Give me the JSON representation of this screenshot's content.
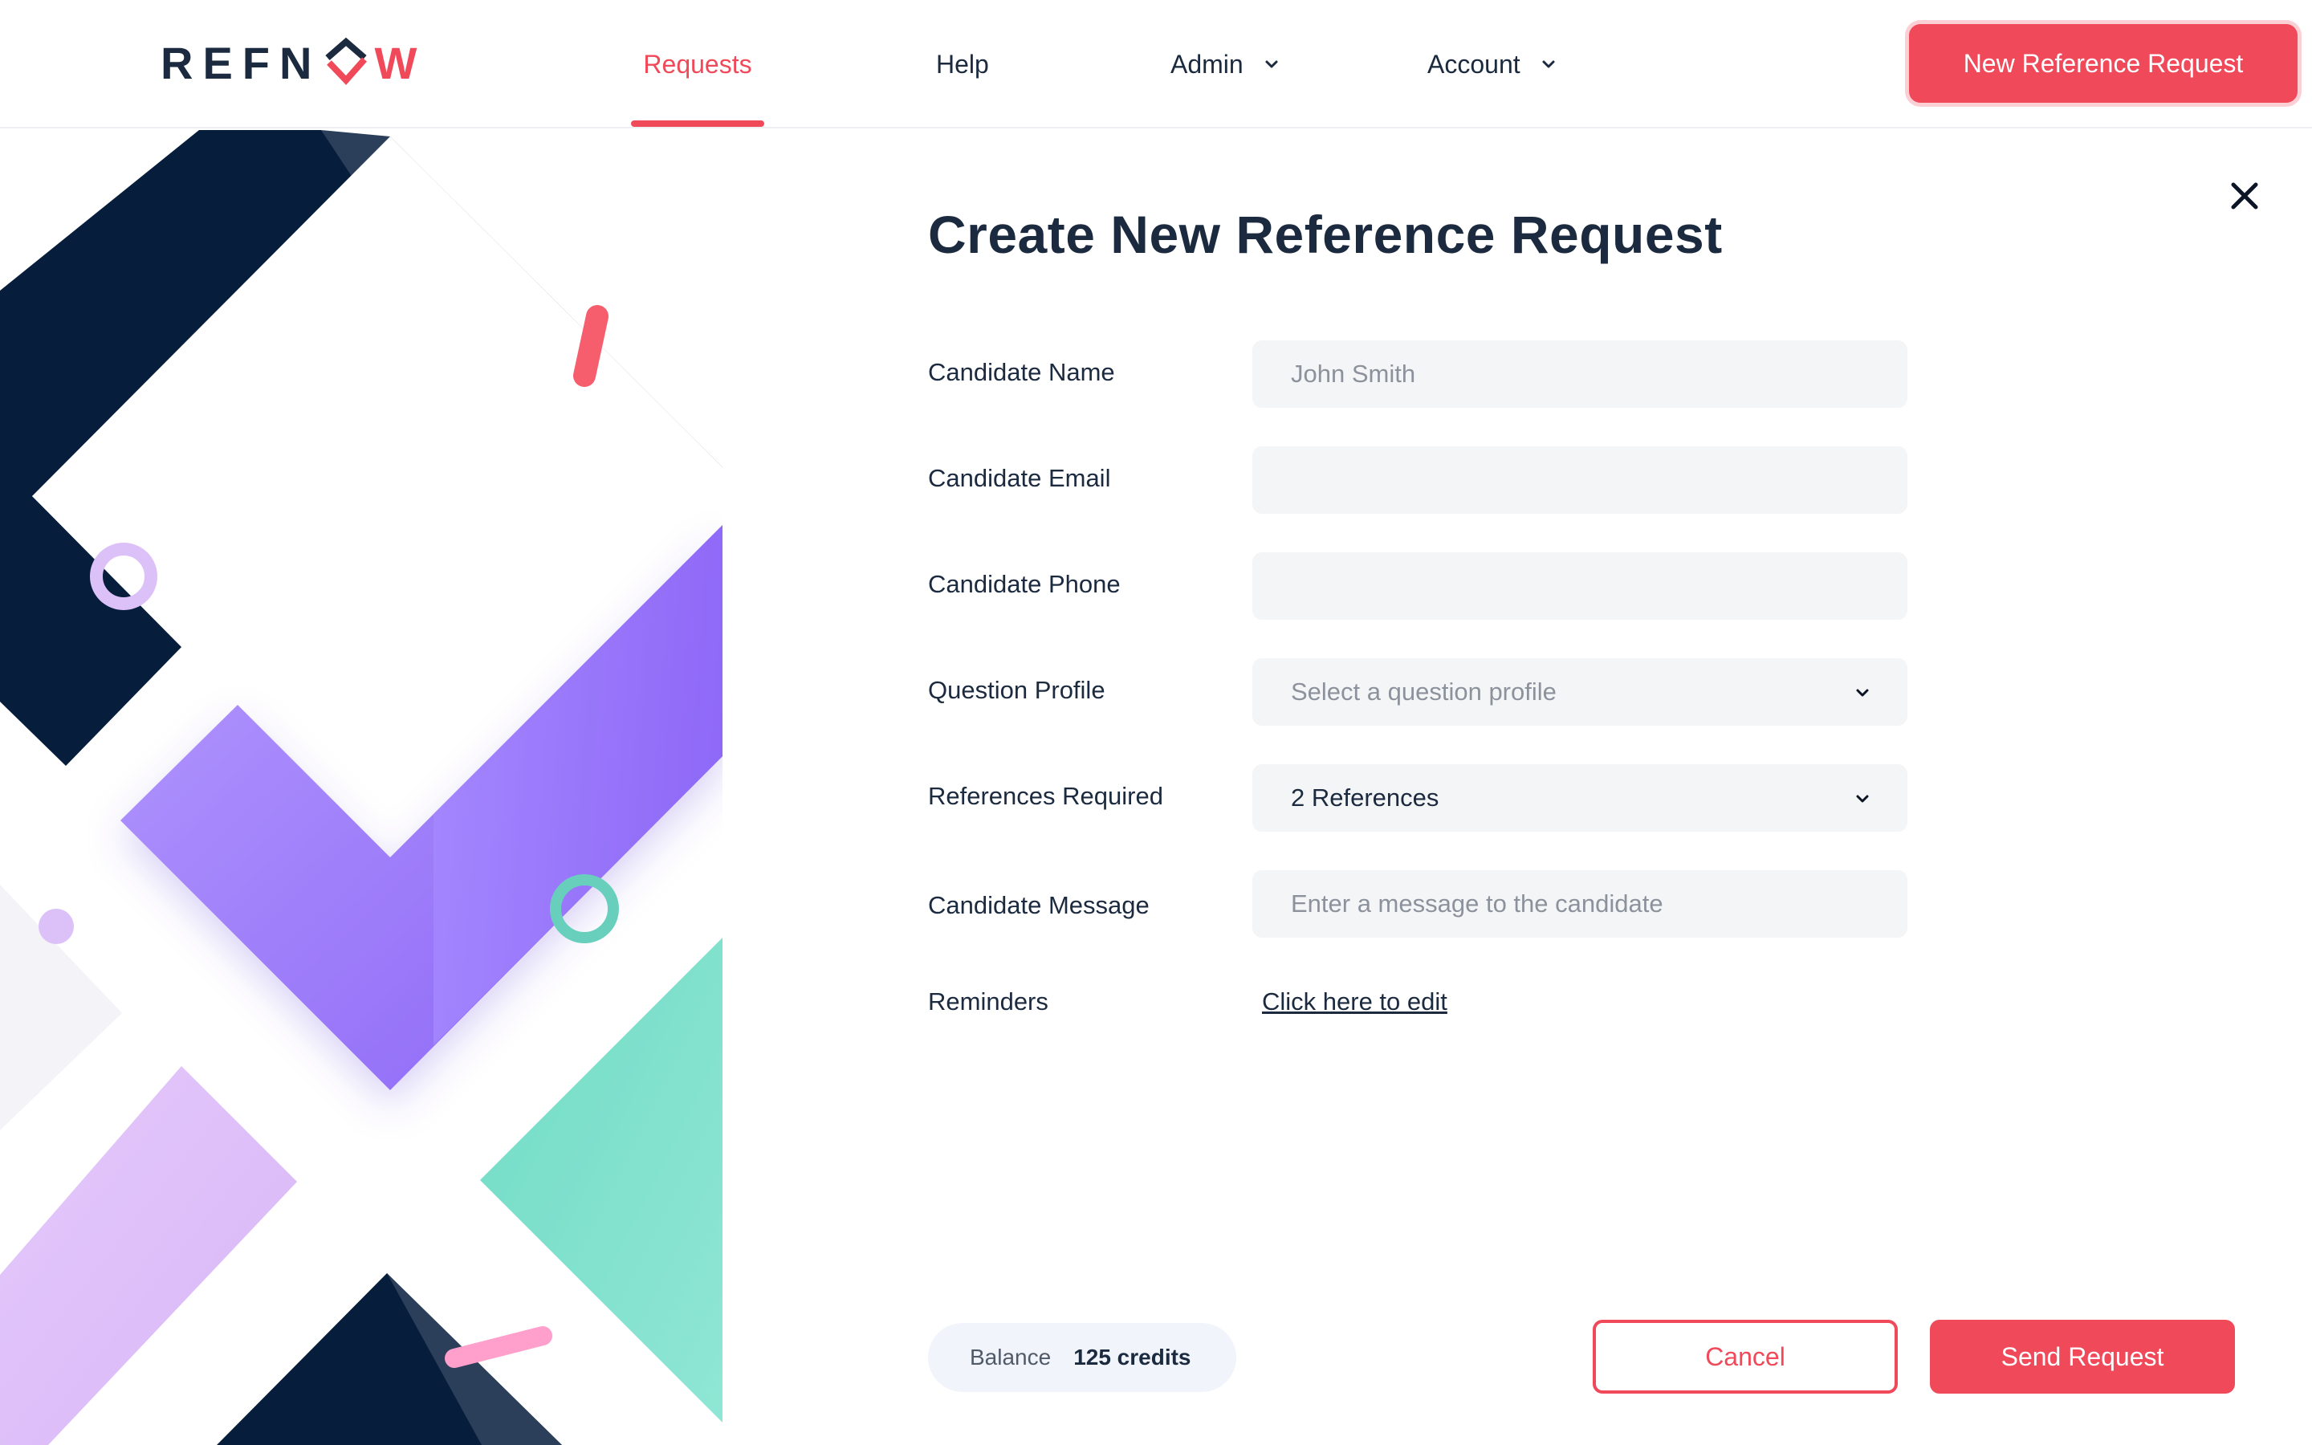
{
  "brand": {
    "logo_prefix": "REFN",
    "logo_suffix": "W",
    "accent_color": "#f04a5a",
    "dark_color": "#1b2a3f"
  },
  "nav": {
    "requests": "Requests",
    "help": "Help",
    "admin": "Admin",
    "account": "Account",
    "active": "Requests",
    "new_request_button": "New Reference Request"
  },
  "form": {
    "title": "Create New Reference Request",
    "fields": {
      "candidate_name": {
        "label": "Candidate Name",
        "value": "",
        "placeholder": "John Smith"
      },
      "candidate_email": {
        "label": "Candidate Email",
        "value": "",
        "placeholder": ""
      },
      "candidate_phone": {
        "label": "Candidate Phone",
        "value": "",
        "placeholder": ""
      },
      "question_profile": {
        "label": "Question Profile",
        "selected": "Select a question profile"
      },
      "references_required": {
        "label": "References Required",
        "selected": "2 References"
      },
      "candidate_message": {
        "label": "Candidate Message",
        "value": "",
        "placeholder": "Enter a message to the candidate"
      },
      "reminders": {
        "label": "Reminders",
        "link": "Click here to edit"
      }
    }
  },
  "footer": {
    "balance_label": "Balance",
    "balance_value": "125 credits",
    "cancel": "Cancel",
    "send": "Send Request"
  },
  "icons": {
    "close": "close-icon",
    "chevron": "chevron-down-icon",
    "logo_mark": "check-diamond-icon"
  }
}
